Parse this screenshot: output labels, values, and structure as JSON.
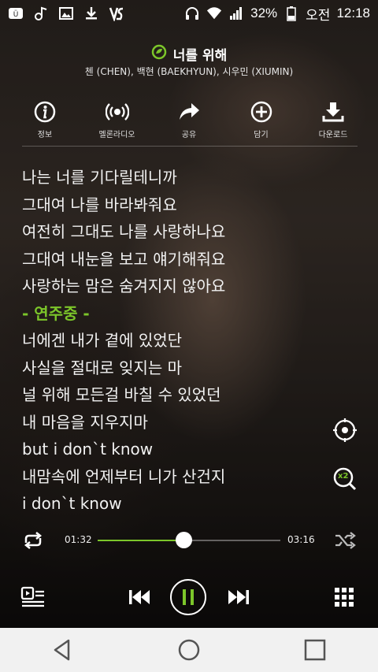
{
  "status_bar": {
    "battery": "32%",
    "ampm": "오전",
    "time": "12:18",
    "left_icons": [
      "talk-icon",
      "music-note-icon",
      "image-icon",
      "download-icon",
      "vs-app-icon"
    ],
    "right_icons": [
      "headphones-icon",
      "wifi-icon",
      "signal-icon",
      "battery-icon"
    ]
  },
  "song": {
    "title": "너를 위해",
    "artists": "첸 (CHEN), 백현 (BAEKHYUN), 시우민 (XIUMIN)",
    "icon": "melon-leaf-icon"
  },
  "actions": [
    {
      "label": "정보",
      "icon": "info-icon"
    },
    {
      "label": "멜론라디오",
      "icon": "radio-icon"
    },
    {
      "label": "공유",
      "icon": "share-icon"
    },
    {
      "label": "담기",
      "icon": "add-icon"
    },
    {
      "label": "다운로드",
      "icon": "download-icon"
    }
  ],
  "lyrics": [
    "나는 너를 기다릴테니까",
    "그대여 나를 바라봐줘요",
    "여전히 그대도 나를 사랑하나요",
    "그대여 내눈을 보고 얘기해줘요",
    "사랑하는 맘은 숨겨지지 않아요",
    "- 연주중 -",
    "너에겐 내가 곁에 있었단",
    "사실을 절대로 잊지는 마",
    "널 위해 모든걸 바칠 수 있었던",
    "내 마음을 지우지마",
    "but i don`t know",
    "내맘속에 언제부터 니가 산건지",
    "i don`t know"
  ],
  "highlight_index": 5,
  "player": {
    "elapsed": "01:32",
    "duration": "03:16",
    "progress_fraction": 0.47,
    "speed_badge": "x2",
    "accent_color": "#7cc62a"
  },
  "icons": {
    "focus": "crosshair-icon",
    "speed": "speed-x2-icon",
    "repeat": "repeat-icon",
    "shuffle": "shuffle-icon",
    "playlist": "playlist-icon",
    "prev": "previous-icon",
    "pause": "pause-icon",
    "next": "next-icon",
    "grid": "grid-menu-icon"
  }
}
